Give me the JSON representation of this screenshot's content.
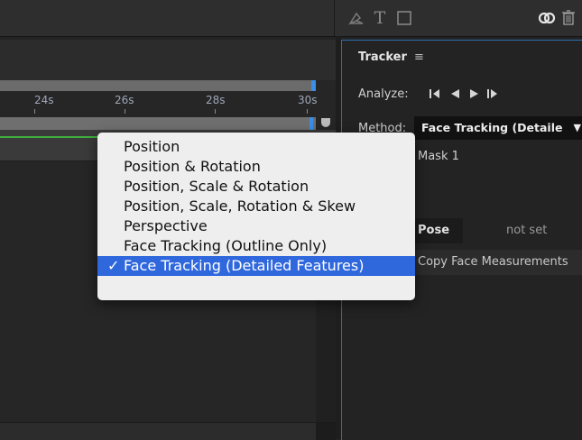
{
  "toolbar": {
    "icons": [
      "pen-icon",
      "text-tool-icon",
      "shape-tool-icon",
      "creative-cloud-icon",
      "trash-icon"
    ],
    "text_tool_glyph": "T"
  },
  "timeline": {
    "ticks": [
      "24s",
      "26s",
      "28s",
      "30s"
    ]
  },
  "tracker": {
    "title": "Tracker",
    "menu_glyph": "≡",
    "analyze_label": "Analyze:",
    "method_label": "Method:",
    "method_value": "Face Tracking (Detaile",
    "mask_label": "Mask 1",
    "rest_pose_button": "Pose",
    "rest_pose_status": "not set",
    "copy_button": "Copy Face Measurements"
  },
  "dropdown": {
    "items": [
      "Position",
      "Position & Rotation",
      "Position, Scale & Rotation",
      "Position, Scale, Rotation & Skew",
      "Perspective",
      "Face Tracking (Outline Only)",
      "Face Tracking (Detailed Features)"
    ],
    "selected_index": 6,
    "check_glyph": "✓"
  },
  "colors": {
    "selection": "#2f67dd",
    "accent_blue": "#3a8ee6",
    "work_area_green": "#3fae3f"
  }
}
